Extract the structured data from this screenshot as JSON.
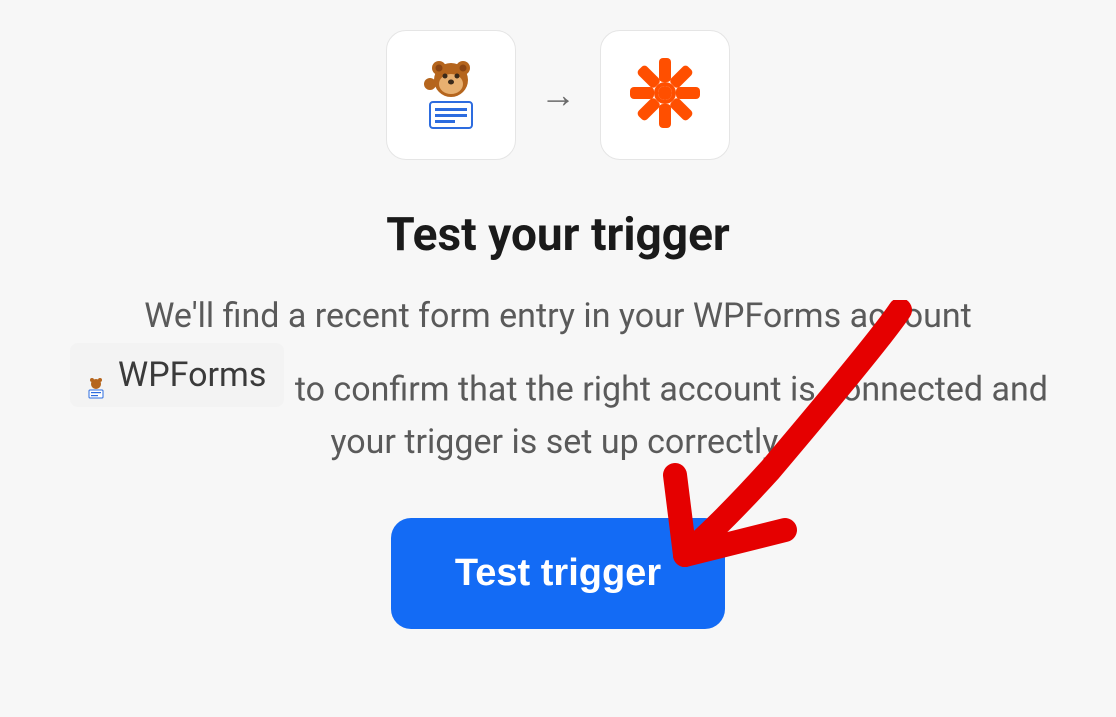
{
  "apps": {
    "source_name": "WPForms",
    "target_name": "Zapier"
  },
  "title": "Test your trigger",
  "description": {
    "before_chip": "We'll find a recent form entry in your WPForms account ",
    "chip_label": "WPForms",
    "after_chip": " to confirm that the right account is connected and your trigger is set up correctly."
  },
  "button": {
    "test_trigger_label": "Test trigger"
  }
}
